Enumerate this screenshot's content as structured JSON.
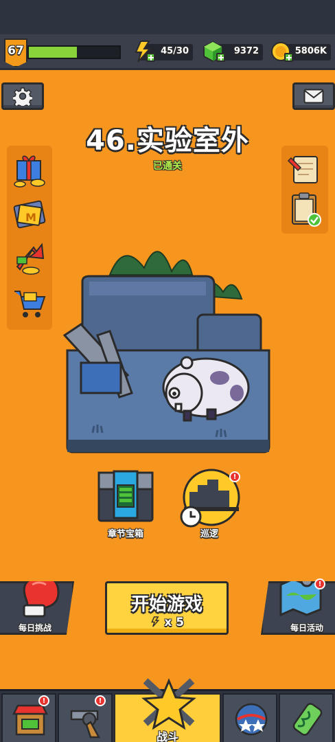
{
  "header": {
    "level": "67",
    "xp_fraction": 0.53,
    "energy": "45/30",
    "gems": "9372",
    "coins": "5806K"
  },
  "chapter": {
    "title": "46.实验室外",
    "status": "已通关"
  },
  "actions": {
    "chapter_chest_label": "章节宝箱",
    "patrol_label": "巡逻",
    "start_label": "开始游戏",
    "start_cost": "x 5",
    "daily_challenge_label": "每日挑战",
    "daily_event_label": "每日活动"
  },
  "nav": {
    "battle_label": "战斗"
  },
  "icons": {
    "settings": "gear-icon",
    "mail": "mail-icon",
    "energy": "lightning-icon",
    "gems": "gem-icon",
    "coins": "coin-icon"
  },
  "colors": {
    "background": "#f7961e",
    "start_button": "#ffd23f",
    "xp_fill": "#8ad23a",
    "cleared_text": "#b6f24a",
    "badge": "#e8332f"
  }
}
